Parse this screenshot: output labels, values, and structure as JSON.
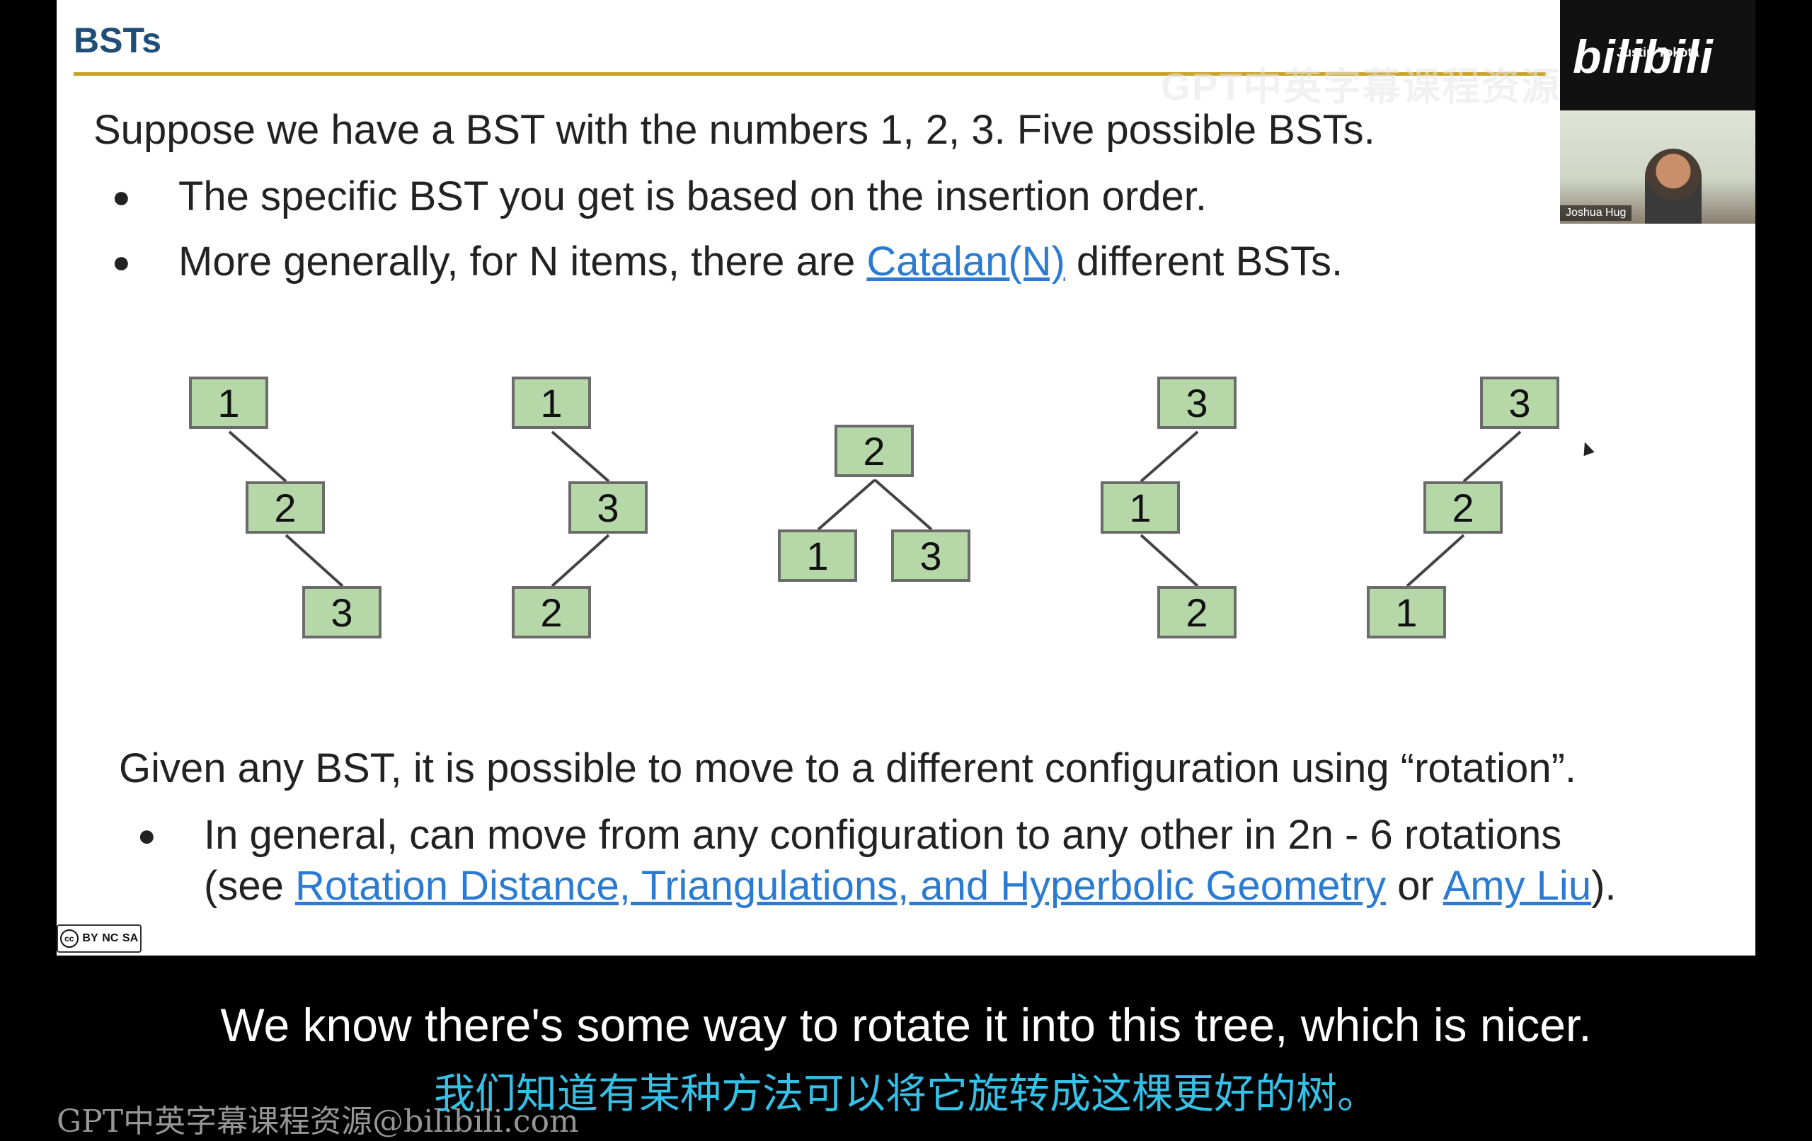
{
  "slide": {
    "title": "BSTs",
    "intro": "Suppose we have a BST with the numbers 1, 2, 3. Five possible BSTs.",
    "bullets": [
      {
        "text": "The specific BST you get is based on the insertion order."
      },
      {
        "pre": "More generally, for N items, there are ",
        "link": "Catalan(N)",
        "post": " different BSTs."
      }
    ],
    "trees": [
      {
        "root": "1",
        "mid": "2",
        "leaf": "3"
      },
      {
        "root": "1",
        "mid": "3",
        "leaf": "2"
      },
      {
        "root": "2",
        "left": "1",
        "right": "3"
      },
      {
        "root": "3",
        "mid": "1",
        "leaf": "2"
      },
      {
        "root": "3",
        "mid": "2",
        "leaf": "1"
      }
    ],
    "rotation_para": "Given any BST, it is possible to move to a different configuration using “rotation”.",
    "rotation_bullet": {
      "line1": "In general, can move from any configuration to any other in 2n - 6 rotations",
      "pre": "(see ",
      "link1": "Rotation Distance, Triangulations, and Hyperbolic Geometry",
      "mid": " or ",
      "link2": "Amy Liu",
      "post": ")."
    },
    "bullet_symbol": "●",
    "license": {
      "cc": "cc",
      "by": "BY",
      "nc": "NC",
      "sa": "SA"
    }
  },
  "webcam": {
    "logo": "bilibili",
    "name_top": "Justin Yokota",
    "name_bottom": "Joshua Hug"
  },
  "subtitles": {
    "english": "We know there's some way to rotate it into this tree, which is nicer.",
    "chinese": "我们知道有某种方法可以将它旋转成这棵更好的树。"
  },
  "watermarks": {
    "top": "GPT中英字幕课程资源",
    "bottom": "GPT中英字幕课程资源@bilibili.com"
  },
  "colors": {
    "title": "#1f4e79",
    "rule": "#c9a227",
    "node_fill": "#b6d7a8",
    "link": "#2a7bd1",
    "subtitle_zh": "#35c0e8"
  }
}
